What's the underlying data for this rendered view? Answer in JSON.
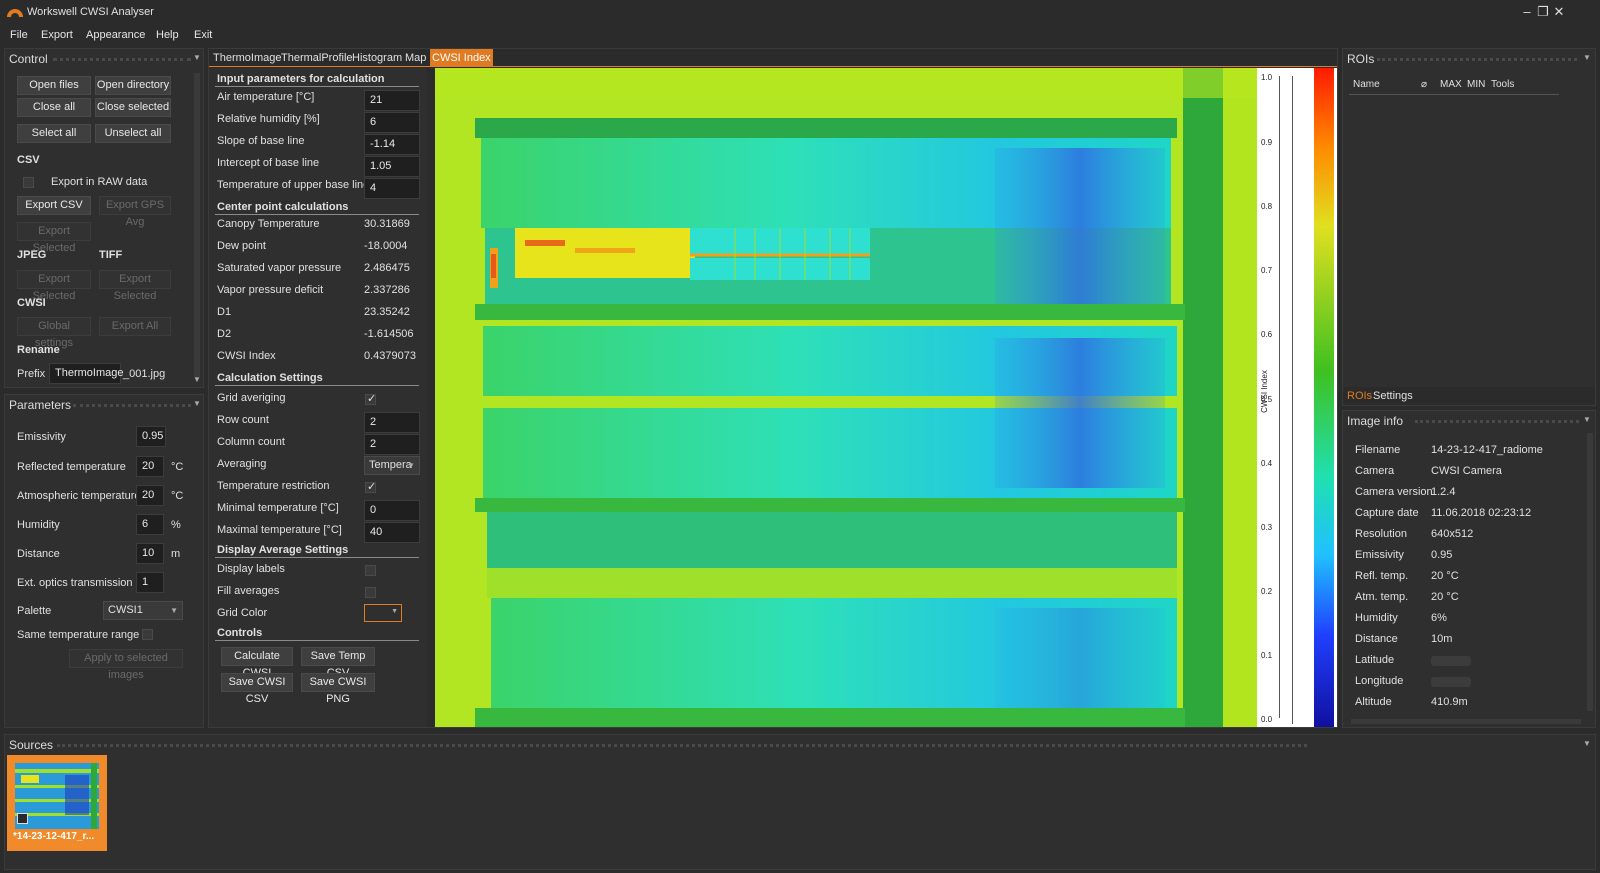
{
  "window": {
    "title": "Workswell CWSI Analyser",
    "controls": [
      "–",
      "❐",
      "✕"
    ]
  },
  "menu": [
    "File",
    "Export",
    "Appearance",
    "Help",
    "Exit"
  ],
  "control_panel": {
    "title": "Control",
    "open_files": "Open files",
    "open_directory": "Open directory",
    "close_all": "Close all",
    "close_selected": "Close selected",
    "select_all": "Select all",
    "unselect_all": "Unselect all",
    "csv_heading": "CSV",
    "export_raw": "Export in RAW data",
    "export_csv": "Export CSV",
    "export_gps_avg": "Export GPS Avg",
    "export_selected_csv": "Export Selected",
    "jpeg_heading": "JPEG",
    "tiff_heading": "TIFF",
    "export_selected_jpeg": "Export Selected",
    "export_selected_tiff": "Export Selected",
    "cwsi_heading": "CWSI",
    "global_settings": "Global settings",
    "export_all": "Export All",
    "rename_heading": "Rename",
    "prefix_label": "Prefix",
    "prefix_value": "ThermoImage",
    "suffix": "_001.jpg"
  },
  "parameters_panel": {
    "title": "Parameters",
    "rows": [
      {
        "label": "Emissivity",
        "value": "0.95",
        "unit": ""
      },
      {
        "label": "Reflected temperature",
        "value": "20",
        "unit": "°C"
      },
      {
        "label": "Atmospheric temperature",
        "value": "20",
        "unit": "°C"
      },
      {
        "label": "Humidity",
        "value": "6",
        "unit": "%"
      },
      {
        "label": "Distance",
        "value": "10",
        "unit": "m"
      },
      {
        "label": "Ext. optics transmission",
        "value": "1",
        "unit": ""
      }
    ],
    "palette_label": "Palette",
    "palette_value": "CWSI1",
    "same_temp_range": "Same temperature range",
    "apply_selected": "Apply to selected images"
  },
  "tabs": [
    "ThermoImage",
    "ThermalProfile",
    "Histogram",
    "Map",
    "CWSI Index"
  ],
  "active_tab": "CWSI Index",
  "cwsi_form": {
    "input_heading": "Input parameters for calculation",
    "inputs": [
      {
        "label": "Air temperature [°C]",
        "value": "21"
      },
      {
        "label": "Relative humidity [%]",
        "value": "6"
      },
      {
        "label": "Slope of base line",
        "value": "-1.14"
      },
      {
        "label": "Intercept of base line",
        "value": "1.05"
      },
      {
        "label": "Temperature of upper base line",
        "value": "4"
      }
    ],
    "center_heading": "Center point calculations",
    "center": [
      {
        "label": "Canopy Temperature",
        "value": "30.31869"
      },
      {
        "label": "Dew point",
        "value": "-18.0004"
      },
      {
        "label": "Saturated vapor pressure",
        "value": "2.486475"
      },
      {
        "label": "Vapor pressure deficit",
        "value": "2.337286"
      },
      {
        "label": "D1",
        "value": "23.35242"
      },
      {
        "label": "D2",
        "value": "-1.614506"
      },
      {
        "label": "CWSI Index",
        "value": "0.4379073"
      }
    ],
    "calc_heading": "Calculation Settings",
    "grid_averaging": "Grid averiging",
    "row_count_label": "Row count",
    "row_count": "2",
    "column_count_label": "Column count",
    "column_count": "2",
    "averaging_label": "Averaging",
    "averaging_value": "Tempera",
    "temp_restriction": "Temperature restriction",
    "min_temp_label": "Minimal temperature [°C]",
    "min_temp": "0",
    "max_temp_label": "Maximal temperature [°C]",
    "max_temp": "40",
    "display_heading": "Display Average Settings",
    "display_labels": "Display labels",
    "fill_averages": "Fill averages",
    "grid_color": "Grid Color",
    "controls_heading": "Controls",
    "calculate_cwsi": "Calculate CWSI",
    "save_temp_csv": "Save Temp CSV",
    "save_cwsi_csv": "Save CWSI CSV",
    "save_cwsi_png": "Save CWSI PNG"
  },
  "colorbar": {
    "axis_label": "CWSI Index",
    "ticks": [
      "1.0",
      "0.9",
      "0.8",
      "0.7",
      "0.6",
      "0.5",
      "0.4",
      "0.3",
      "0.2",
      "0.1",
      "0.0"
    ]
  },
  "rois_panel": {
    "title": "ROIs",
    "columns": [
      "Name",
      "⌀",
      "MAX",
      "MIN",
      "Tools"
    ],
    "tabs": [
      "ROIs",
      "Settings"
    ]
  },
  "image_info": {
    "title": "Image info",
    "rows": [
      {
        "key": "Filename",
        "value": "14-23-12-417_radiometric.jpg"
      },
      {
        "key": "Camera",
        "value": "CWSI Camera"
      },
      {
        "key": "Camera version",
        "value": "1.2.4"
      },
      {
        "key": "Capture date",
        "value": "11.06.2018 02:23:12"
      },
      {
        "key": "Resolution",
        "value": "640x512"
      },
      {
        "key": "Emissivity",
        "value": "0.95"
      },
      {
        "key": "Refl. temp.",
        "value": "20 °C"
      },
      {
        "key": "Atm. temp.",
        "value": "20 °C"
      },
      {
        "key": "Humidity",
        "value": "6%"
      },
      {
        "key": "Distance",
        "value": "10m"
      },
      {
        "key": "Latitude",
        "value": ""
      },
      {
        "key": "Longitude",
        "value": ""
      },
      {
        "key": "Altitude",
        "value": "410.9m"
      }
    ]
  },
  "sources": {
    "title": "Sources",
    "thumb_label": "*14-23-12-417_r..."
  },
  "colors": {
    "accent": "#e07b22",
    "panel": "#2f2f2f",
    "background": "#2b2b2b"
  }
}
